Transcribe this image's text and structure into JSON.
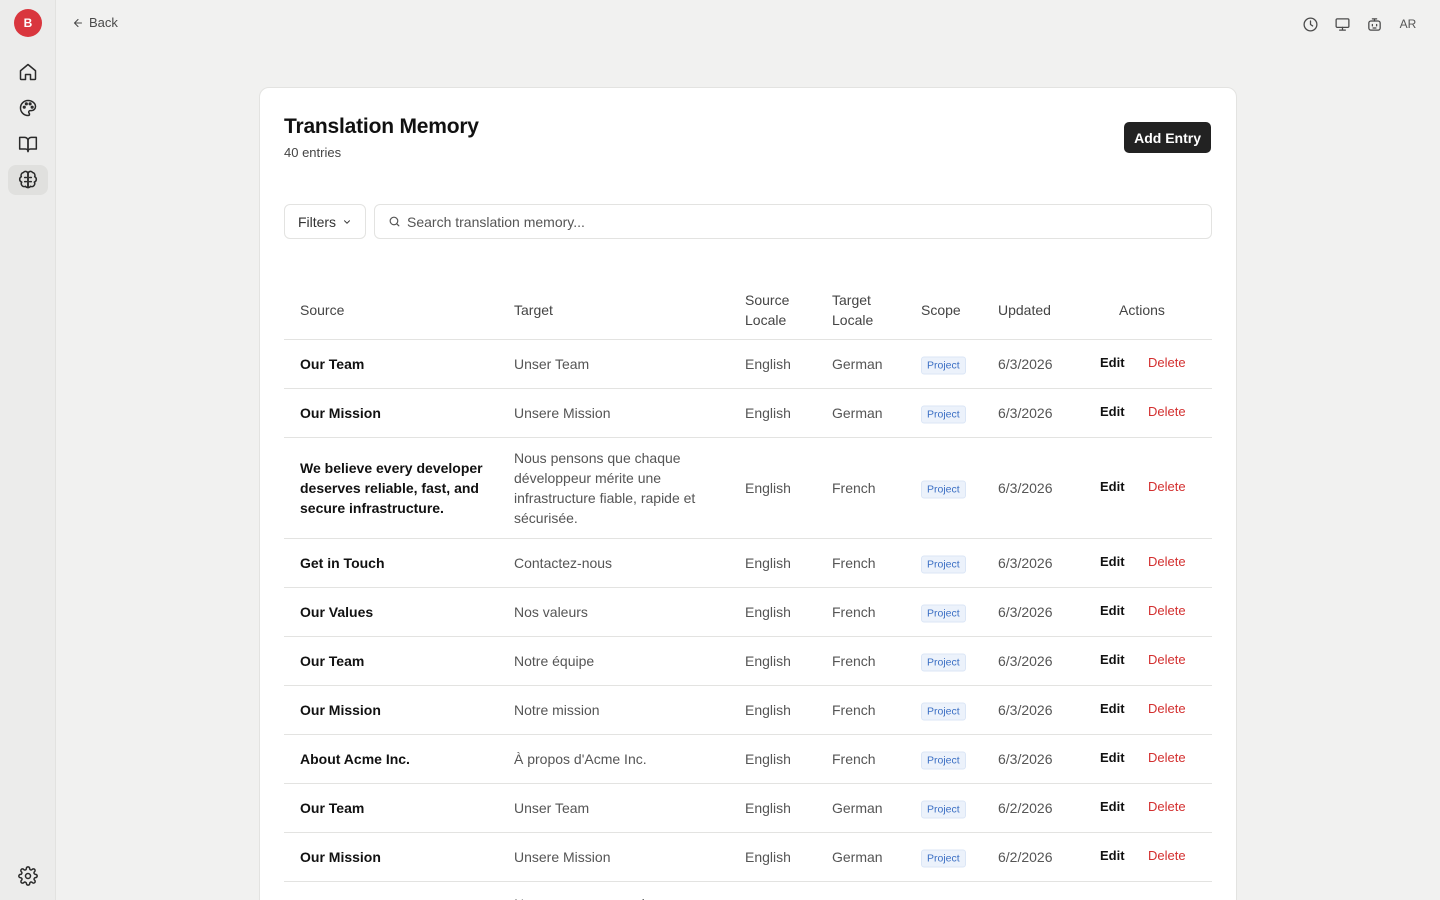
{
  "app": {
    "brand_letter": "B",
    "back_label": "Back",
    "user_initials": "AR"
  },
  "sidebar": {
    "items": [
      {
        "icon": "home-icon"
      },
      {
        "icon": "palette-icon"
      },
      {
        "icon": "book-icon"
      },
      {
        "icon": "brain-icon",
        "active": true
      }
    ],
    "bottom_icon": "settings-icon"
  },
  "topbar": {
    "icons": [
      "history-icon",
      "monitor-icon",
      "bot-icon"
    ]
  },
  "page": {
    "title": "Translation Memory",
    "subtitle": "40 entries",
    "add_button": "Add Entry",
    "filters_label": "Filters",
    "search_placeholder": "Search translation memory..."
  },
  "table": {
    "headers": {
      "source": "Source",
      "target": "Target",
      "source_locale": "Source Locale",
      "target_locale": "Target Locale",
      "scope": "Scope",
      "updated": "Updated",
      "actions": "Actions"
    },
    "edit_label": "Edit",
    "delete_label": "Delete",
    "rows": [
      {
        "source": "Our Team",
        "target": "Unser Team",
        "source_locale": "English",
        "target_locale": "German",
        "scope": "Project",
        "updated": "6/3/2026"
      },
      {
        "source": "Our Mission",
        "target": "Unsere Mission",
        "source_locale": "English",
        "target_locale": "German",
        "scope": "Project",
        "updated": "6/3/2026"
      },
      {
        "source": "We believe every developer deserves reliable, fast, and secure infrastructure.",
        "target": "Nous pensons que chaque développeur mérite une infrastructure fiable, rapide et sécurisée.",
        "source_locale": "English",
        "target_locale": "French",
        "scope": "Project",
        "updated": "6/3/2026"
      },
      {
        "source": "Get in Touch",
        "target": "Contactez-nous",
        "source_locale": "English",
        "target_locale": "French",
        "scope": "Project",
        "updated": "6/3/2026"
      },
      {
        "source": "Our Values",
        "target": "Nos valeurs",
        "source_locale": "English",
        "target_locale": "French",
        "scope": "Project",
        "updated": "6/3/2026"
      },
      {
        "source": "Our Team",
        "target": "Notre équipe",
        "source_locale": "English",
        "target_locale": "French",
        "scope": "Project",
        "updated": "6/3/2026"
      },
      {
        "source": "Our Mission",
        "target": "Notre mission",
        "source_locale": "English",
        "target_locale": "French",
        "scope": "Project",
        "updated": "6/3/2026"
      },
      {
        "source": "About Acme Inc.",
        "target": "À propos d'Acme Inc.",
        "source_locale": "English",
        "target_locale": "French",
        "scope": "Project",
        "updated": "6/3/2026"
      },
      {
        "source": "Our Team",
        "target": "Unser Team",
        "source_locale": "English",
        "target_locale": "German",
        "scope": "Project",
        "updated": "6/2/2026"
      },
      {
        "source": "Our Mission",
        "target": "Unsere Mission",
        "source_locale": "English",
        "target_locale": "German",
        "scope": "Project",
        "updated": "6/2/2026"
      },
      {
        "source": "",
        "target": "Nous pensons que chaque",
        "source_locale": "",
        "target_locale": "",
        "scope": "",
        "updated": ""
      }
    ]
  }
}
